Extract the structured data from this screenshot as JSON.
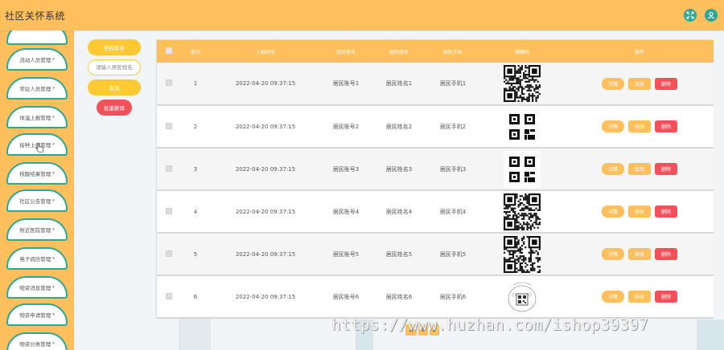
{
  "app": {
    "title": "社区关怀系统"
  },
  "header": {
    "tool_icons": [
      "fullscreen-icon",
      "user-icon"
    ],
    "accent": "#ffbf5c",
    "icon_color": "#2aa89a"
  },
  "sidebar": {
    "items": [
      {
        "label": ""
      },
      {
        "label": "流动人员管理"
      },
      {
        "label": "常驻人员管理"
      },
      {
        "label": "体温上报管理"
      },
      {
        "label": "接种上报管理"
      },
      {
        "label": "核酸结果管理"
      },
      {
        "label": "社区公告管理"
      },
      {
        "label": "附近医院管理"
      },
      {
        "label": "电子病历管理"
      },
      {
        "label": "物资消息管理"
      },
      {
        "label": "物资申请管理"
      },
      {
        "label": "物资分类管理"
      }
    ],
    "caret": "▾"
  },
  "search": {
    "field_label": "居民姓名",
    "input_placeholder": "请输入居民姓名",
    "query_button": "查询",
    "batch_delete_button": "批量删除"
  },
  "table": {
    "headers": [
      "",
      "索引",
      "上报时间",
      "居民账号",
      "居民姓名",
      "居民手机",
      "健康码",
      "操作"
    ],
    "rows": [
      {
        "index": "1",
        "time": "2022-04-20 09:37:15",
        "account": "居民账号1",
        "name": "居民姓名1",
        "phone": "居民手机1",
        "code": "dense"
      },
      {
        "index": "2",
        "time": "2022-04-20 09:37:15",
        "account": "居民账号2",
        "name": "居民姓名2",
        "phone": "居民手机2",
        "code": "simple"
      },
      {
        "index": "3",
        "time": "2022-04-20 09:37:15",
        "account": "居民账号3",
        "name": "居民姓名3",
        "phone": "居民手机3",
        "code": "simple"
      },
      {
        "index": "4",
        "time": "2022-04-20 09:37:15",
        "account": "居民账号4",
        "name": "居民姓名4",
        "phone": "居民手机4",
        "code": "dense"
      },
      {
        "index": "5",
        "time": "2022-04-20 09:37:15",
        "account": "居民账号5",
        "name": "居民姓名5",
        "phone": "居民手机5",
        "code": "dense"
      },
      {
        "index": "6",
        "time": "2022-04-20 09:37:15",
        "account": "居民账号6",
        "name": "居民姓名6",
        "phone": "居民手机6",
        "code": "sketch"
      }
    ],
    "row_actions": {
      "view": "详情",
      "edit": "修改",
      "delete": "删除"
    }
  },
  "pager": {
    "items": [
      "1/",
      "1",
      "2"
    ]
  },
  "watermark": "https://www.huzhan.com/ishop39397"
}
